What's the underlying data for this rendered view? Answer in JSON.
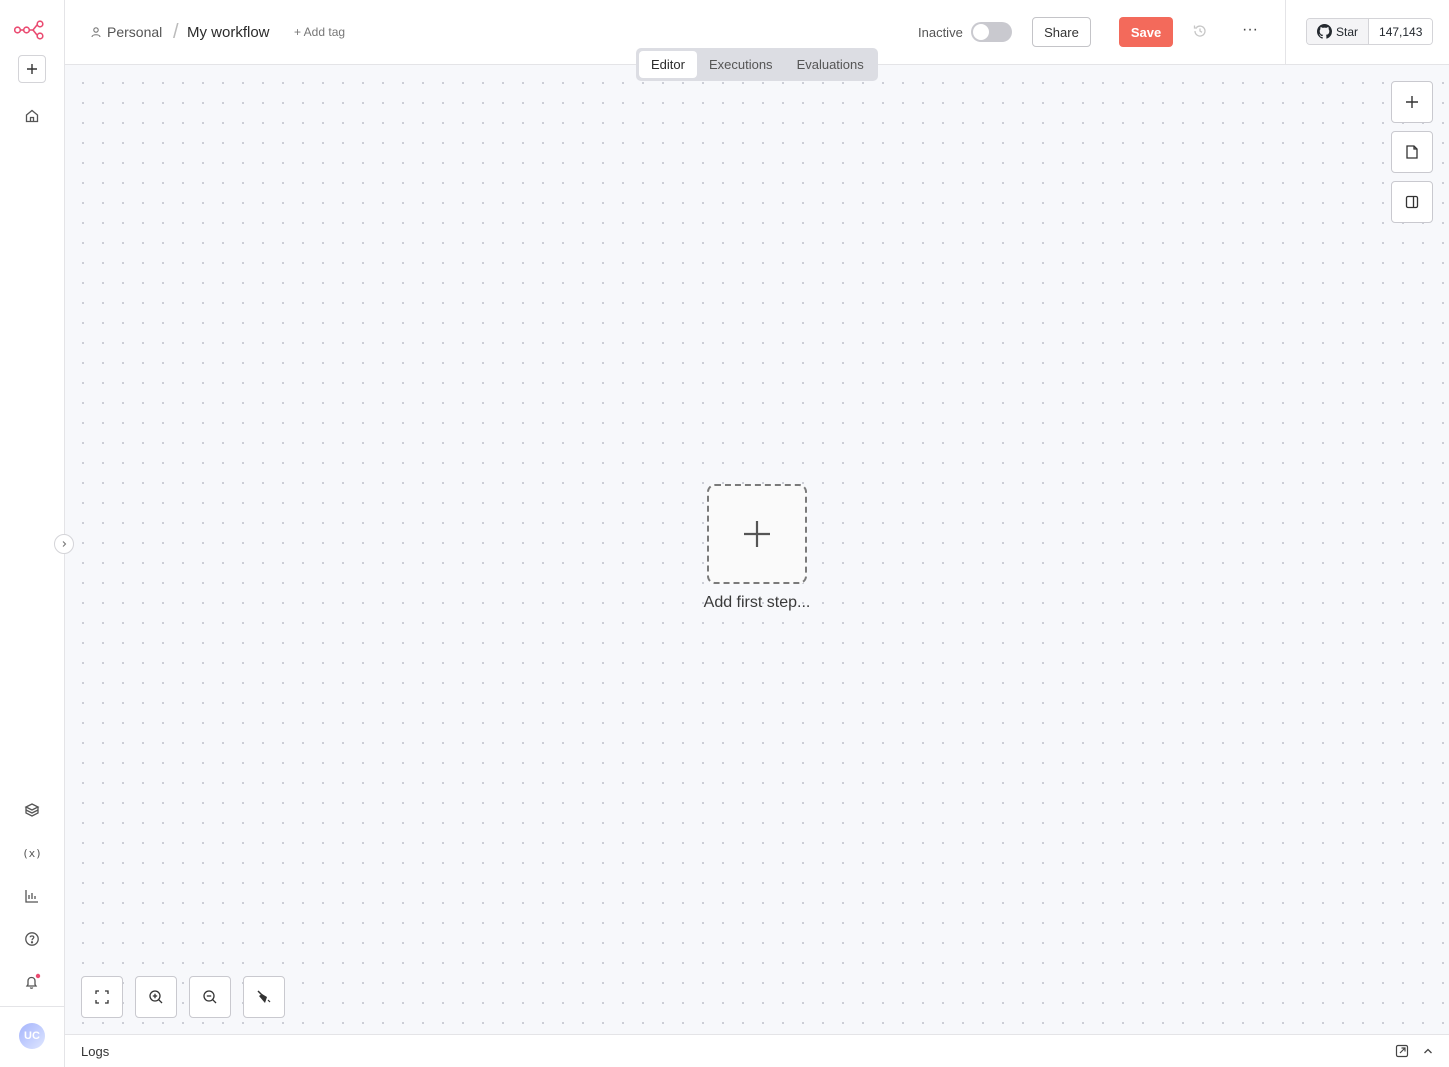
{
  "colors": {
    "accent": "#f36a5b",
    "logo": "#ea4b71",
    "canvas_bg": "#f7f8fb"
  },
  "header": {
    "breadcrumb_project": "Personal",
    "breadcrumb_separator": "/",
    "workflow_title": "My workflow",
    "add_tag": "+ Add tag",
    "status_label": "Inactive",
    "active": false,
    "share_label": "Share",
    "save_label": "Save",
    "more_label": "···",
    "github": {
      "star_label": "Star",
      "star_count": "147,143"
    }
  },
  "tabs": [
    {
      "label": "Editor",
      "active": true
    },
    {
      "label": "Executions",
      "active": false
    },
    {
      "label": "Evaluations",
      "active": false
    }
  ],
  "canvas": {
    "add_first_step": "Add first step..."
  },
  "sidebar": {
    "avatar_initials": "UC"
  },
  "logs": {
    "label": "Logs"
  }
}
